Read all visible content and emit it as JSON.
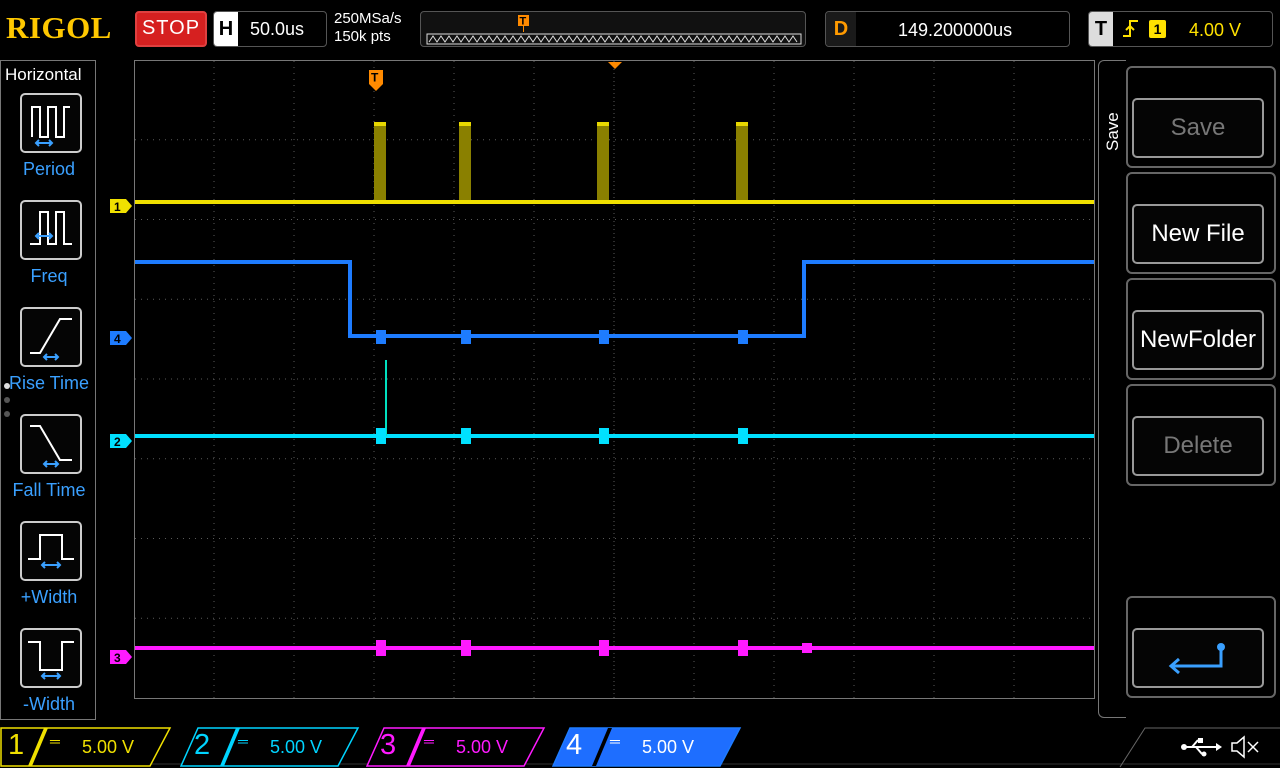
{
  "header": {
    "brand": "RIGOL",
    "run_state": "STOP",
    "h_letter": "H",
    "timebase": "50.0us",
    "sample_rate": "250MSa/s",
    "mem_depth": "150k pts",
    "trigger_marker": "T",
    "d_letter": "D",
    "delay": "149.200000us",
    "t_letter": "T",
    "trigger_source": "1",
    "trigger_level": "4.00 V"
  },
  "left_menu": {
    "title": "Horizontal",
    "items": [
      {
        "label": "Period",
        "icon": "period-icon"
      },
      {
        "label": "Freq",
        "icon": "freq-icon"
      },
      {
        "label": "Rise Time",
        "icon": "rise-time-icon"
      },
      {
        "label": "Fall Time",
        "icon": "fall-time-icon"
      },
      {
        "label": "+Width",
        "icon": "pos-width-icon"
      },
      {
        "label": "-Width",
        "icon": "neg-width-icon"
      }
    ]
  },
  "screen": {
    "trigger_marker": "T",
    "channel_markers": [
      {
        "ch": "1",
        "color": "#f0e000"
      },
      {
        "ch": "4",
        "color": "#1e7cff"
      },
      {
        "ch": "2",
        "color": "#00e0ff"
      },
      {
        "ch": "3",
        "color": "#ff1aff"
      }
    ]
  },
  "right_menu": {
    "title": "Save",
    "buttons": [
      {
        "label": "Save",
        "enabled": false
      },
      {
        "label": "New File",
        "enabled": true
      },
      {
        "label": "NewFolder",
        "enabled": true
      },
      {
        "label": "Delete",
        "enabled": false
      },
      {
        "label": "",
        "icon": "return-icon",
        "enabled": true
      }
    ]
  },
  "channels": [
    {
      "num": "1",
      "scale": "5.00 V",
      "color": "#f0e000"
    },
    {
      "num": "2",
      "scale": "5.00 V",
      "color": "#00d4ff"
    },
    {
      "num": "3",
      "scale": "5.00 V",
      "color": "#ff1aff"
    },
    {
      "num": "4",
      "scale": "5.00 V",
      "color": "#1e7cff"
    }
  ],
  "status_icons": [
    "usb-icon",
    "mute-icon"
  ]
}
